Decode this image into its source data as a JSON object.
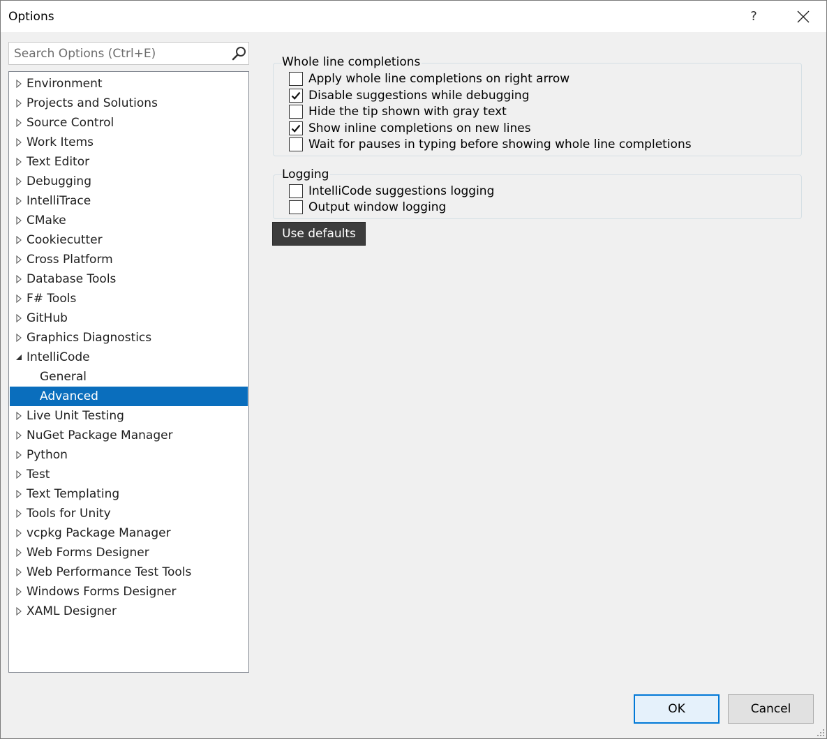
{
  "window": {
    "title": "Options",
    "help_label": "?"
  },
  "search": {
    "placeholder": "Search Options (Ctrl+E)"
  },
  "tree": {
    "items": [
      {
        "label": "Environment",
        "state": "collapsed"
      },
      {
        "label": "Projects and Solutions",
        "state": "collapsed"
      },
      {
        "label": "Source Control",
        "state": "collapsed"
      },
      {
        "label": "Work Items",
        "state": "collapsed"
      },
      {
        "label": "Text Editor",
        "state": "collapsed"
      },
      {
        "label": "Debugging",
        "state": "collapsed"
      },
      {
        "label": "IntelliTrace",
        "state": "collapsed"
      },
      {
        "label": "CMake",
        "state": "collapsed"
      },
      {
        "label": "Cookiecutter",
        "state": "collapsed"
      },
      {
        "label": "Cross Platform",
        "state": "collapsed"
      },
      {
        "label": "Database Tools",
        "state": "collapsed"
      },
      {
        "label": "F# Tools",
        "state": "collapsed"
      },
      {
        "label": "GitHub",
        "state": "collapsed"
      },
      {
        "label": "Graphics Diagnostics",
        "state": "collapsed"
      },
      {
        "label": "IntelliCode",
        "state": "expanded"
      },
      {
        "label": "General",
        "state": "child"
      },
      {
        "label": "Advanced",
        "state": "child-selected"
      },
      {
        "label": "Live Unit Testing",
        "state": "collapsed"
      },
      {
        "label": "NuGet Package Manager",
        "state": "collapsed"
      },
      {
        "label": "Python",
        "state": "collapsed"
      },
      {
        "label": "Test",
        "state": "collapsed"
      },
      {
        "label": "Text Templating",
        "state": "collapsed"
      },
      {
        "label": "Tools for Unity",
        "state": "collapsed"
      },
      {
        "label": "vcpkg Package Manager",
        "state": "collapsed"
      },
      {
        "label": "Web Forms Designer",
        "state": "collapsed"
      },
      {
        "label": "Web Performance Test Tools",
        "state": "collapsed"
      },
      {
        "label": "Windows Forms Designer",
        "state": "collapsed"
      },
      {
        "label": "XAML Designer",
        "state": "collapsed"
      }
    ]
  },
  "whole_line": {
    "title": "Whole line completions",
    "options": [
      {
        "label": "Apply whole line completions on right arrow",
        "checked": false
      },
      {
        "label": "Disable suggestions while debugging",
        "checked": true
      },
      {
        "label": "Hide the tip shown with gray text",
        "checked": false
      },
      {
        "label": "Show inline completions on new lines",
        "checked": true
      },
      {
        "label": "Wait for pauses in typing before showing whole line completions",
        "checked": false
      }
    ]
  },
  "logging": {
    "title": "Logging",
    "options": [
      {
        "label": "IntelliCode suggestions logging",
        "checked": false
      },
      {
        "label": "Output window logging",
        "checked": false
      }
    ]
  },
  "buttons": {
    "use_defaults": "Use defaults",
    "ok": "OK",
    "cancel": "Cancel"
  },
  "colors": {
    "selection": "#0a6ebd",
    "ok_border": "#0078d7",
    "use_defaults_bg": "#3c3c3c"
  }
}
